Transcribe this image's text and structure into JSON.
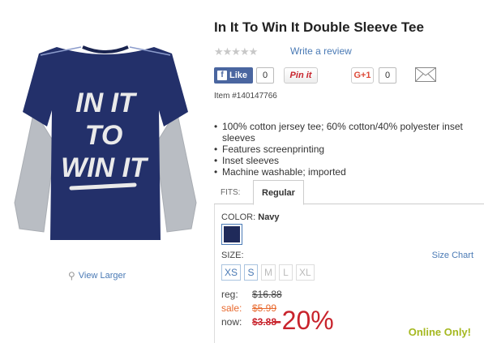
{
  "product": {
    "title": "In It To Win It Double Sleeve Tee",
    "item_number": "Item #140147766",
    "view_larger": "View Larger",
    "shirt_print": [
      "IN IT",
      "TO",
      "WIN IT"
    ]
  },
  "reviews": {
    "stars": "★★★★★",
    "rating": 0,
    "write_review": "Write a review"
  },
  "social": {
    "facebook_label": "Like",
    "facebook_count": "0",
    "pinterest_label": "Pin it",
    "gplus_label": "G+1",
    "gplus_count": "0"
  },
  "features": [
    "100% cotton jersey tee; 60% cotton/40% polyester inset sleeves",
    "Features screenprinting",
    "Inset sleeves",
    "Machine washable; imported"
  ],
  "fits": {
    "label": "FITS:",
    "selected_tab": "Regular"
  },
  "color": {
    "label": "COLOR:",
    "selected": "Navy",
    "swatch_hex": "#1f2a5a"
  },
  "size": {
    "label": "SIZE:",
    "chart_link": "Size Chart",
    "options": [
      {
        "label": "XS",
        "available": true
      },
      {
        "label": "S",
        "available": true
      },
      {
        "label": "M",
        "available": false
      },
      {
        "label": "L",
        "available": false
      },
      {
        "label": "XL",
        "available": false
      }
    ]
  },
  "pricing": {
    "reg_label": "reg:",
    "reg_price": "$16.88",
    "sale_label": "sale:",
    "sale_price": "$5.99",
    "now_label": "now:",
    "now_price": "$3.88",
    "discount": "-20%"
  },
  "badge": {
    "online_only": "Online Only!"
  },
  "colors": {
    "link": "#4a7ab5",
    "price_red": "#c8232c",
    "sale_orange": "#e8692e",
    "online_green": "#a5b820",
    "facebook_blue": "#4a66a0",
    "shirt_navy": "#23306a",
    "sleeve_gray": "#b8bcc2"
  }
}
